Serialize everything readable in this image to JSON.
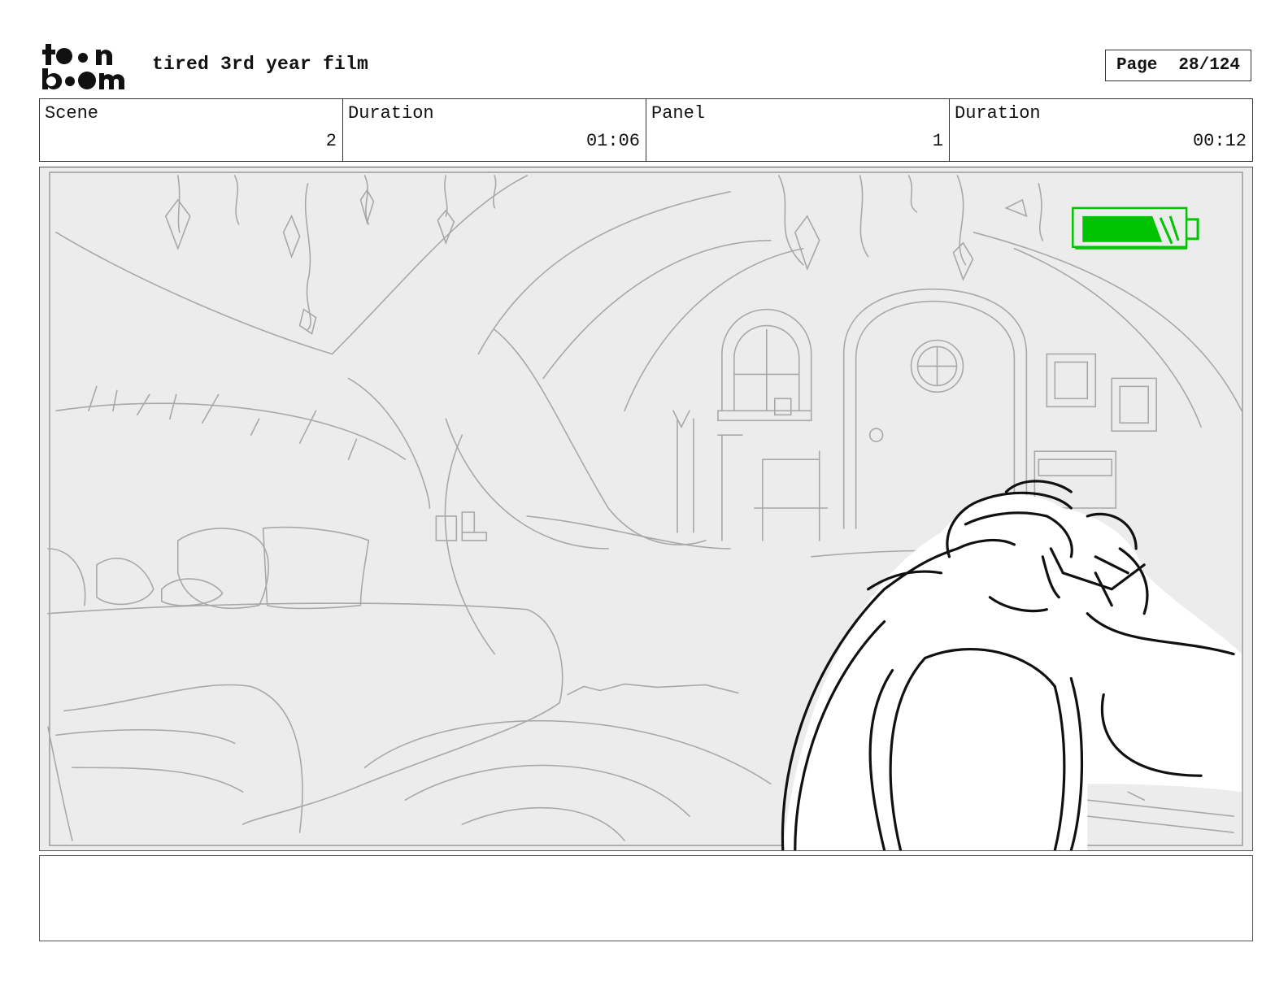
{
  "header": {
    "logo_text_top": "toon",
    "logo_text_bottom": "boom",
    "project_title": "tired 3rd year film",
    "page_label": "Page",
    "page_number": "28/124"
  },
  "info": {
    "scene_label": "Scene",
    "scene_value": "2",
    "scene_duration_label": "Duration",
    "scene_duration_value": "01:06",
    "panel_label": "Panel",
    "panel_value": "1",
    "panel_duration_label": "Duration",
    "panel_duration_value": "00:12"
  },
  "panel_drawing": {
    "icons": [
      "battery-icon"
    ],
    "colors": {
      "battery": "#00c400",
      "sketch_background": "#ececec",
      "sketch_line": "#a8a8a8",
      "ink": "#111111"
    }
  },
  "notes": {
    "text": ""
  }
}
